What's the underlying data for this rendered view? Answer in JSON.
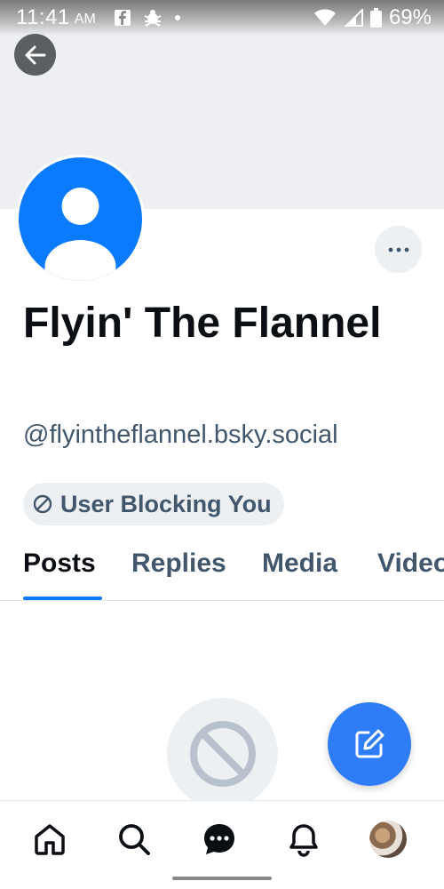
{
  "status_bar": {
    "time": "11:41",
    "ampm": "AM",
    "battery": "69%"
  },
  "profile": {
    "display_name": "Flyin' The Flannel",
    "handle": "@flyintheflannel.bsky.social",
    "blocked_label": "User Blocking You"
  },
  "tabs": [
    {
      "label": "Posts",
      "active": true
    },
    {
      "label": "Replies",
      "active": false
    },
    {
      "label": "Media",
      "active": false
    },
    {
      "label": "Video",
      "active": false
    }
  ],
  "icons": {
    "back": "arrow-left-icon",
    "more": "ellipsis-icon",
    "blocked": "block-icon",
    "compose": "compose-icon",
    "nav": [
      "home-icon",
      "search-icon",
      "chat-icon",
      "bell-icon",
      "profile-avatar"
    ]
  },
  "colors": {
    "accent": "#0a7aff",
    "fab": "#2e7cf6",
    "muted_text": "#42576c"
  }
}
